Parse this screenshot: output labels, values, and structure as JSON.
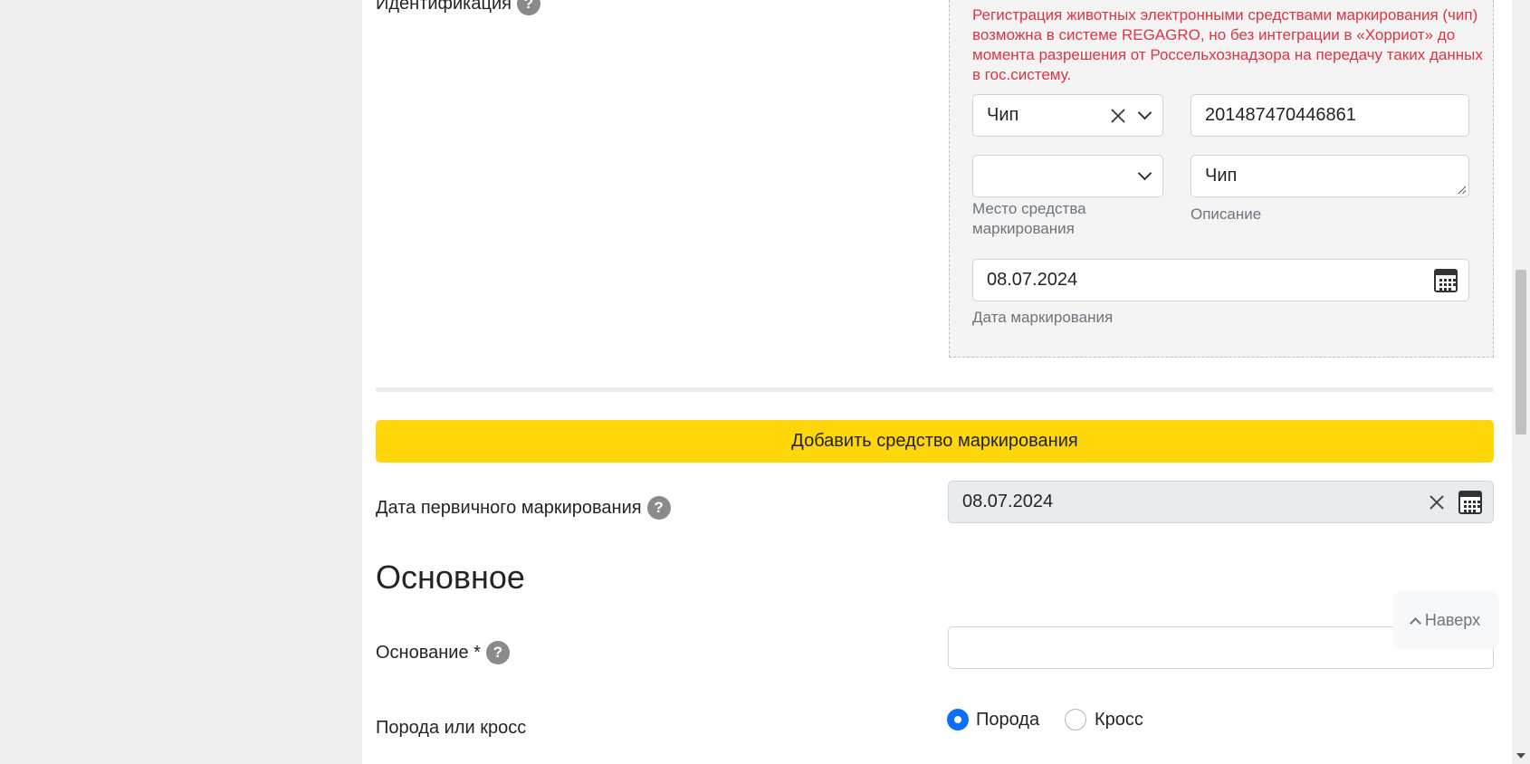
{
  "identification": {
    "label": "Идентификация",
    "help": "?",
    "warning": "Регистрация животных электронными средствами маркирования (чип) возможна в системе REGAGRO, но без интеграции в «Хорриот» до момента разрешения от Россельхознадзора на передачу таких данных в гос.систему.",
    "type_value": "Чип",
    "number_value": "201487470446861",
    "place_value": "",
    "place_label": "Место средства маркирования",
    "description_value": "Чип",
    "description_label": "Описание",
    "marking_date_value": "08.07.2024",
    "marking_date_label": "Дата маркирования"
  },
  "add_marking_button": "Добавить средство маркирования",
  "primary_marking": {
    "label": "Дата первичного маркирования",
    "help": "?",
    "value": "08.07.2024"
  },
  "section_title": "Основное",
  "basis": {
    "label": "Основание *",
    "help": "?",
    "value": ""
  },
  "breed_or_cross": {
    "label": "Порода или кросс",
    "options": [
      "Порода",
      "Кросс"
    ],
    "selected": "Порода"
  },
  "to_top_button": "Наверх",
  "colors": {
    "accent_yellow": "#ffd60a",
    "warning_red": "#dc3545",
    "radio_blue": "#0d6efd"
  }
}
